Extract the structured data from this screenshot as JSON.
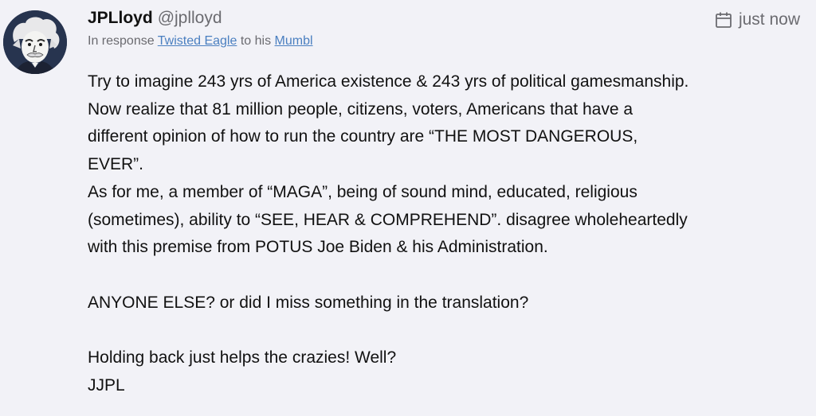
{
  "author": {
    "display_name": "JPLloyd",
    "handle": "@jplloyd"
  },
  "reply": {
    "prefix": "In response",
    "user_link": "Twisted Eagle",
    "middle": "to his",
    "post_link": "Mumbl"
  },
  "timestamp": {
    "label": "just now",
    "icon": "calendar-icon"
  },
  "post_lines": [
    "Try to imagine 243 yrs of America existence & 243 yrs of political gamesmanship.",
    "Now realize that 81 million people, citizens, voters, Americans that have a",
    "different opinion of how to run the country are “THE MOST DANGEROUS,",
    "EVER”.",
    "As for me, a member of “MAGA”, being of sound mind, educated, religious",
    "(sometimes), ability to “SEE, HEAR & COMPREHEND”. disagree wholeheartedly",
    "with this premise from POTUS Joe Biden & his Administration.",
    "",
    "ANYONE ELSE? or did I miss something in the translation?",
    "",
    "Holding back just helps the crazies! Well?",
    "JJPL"
  ],
  "colors": {
    "background": "#f2f2f7",
    "text": "#111111",
    "muted": "#6b6b70",
    "link": "#4a7fc0",
    "avatar_bg": "#27344f"
  }
}
